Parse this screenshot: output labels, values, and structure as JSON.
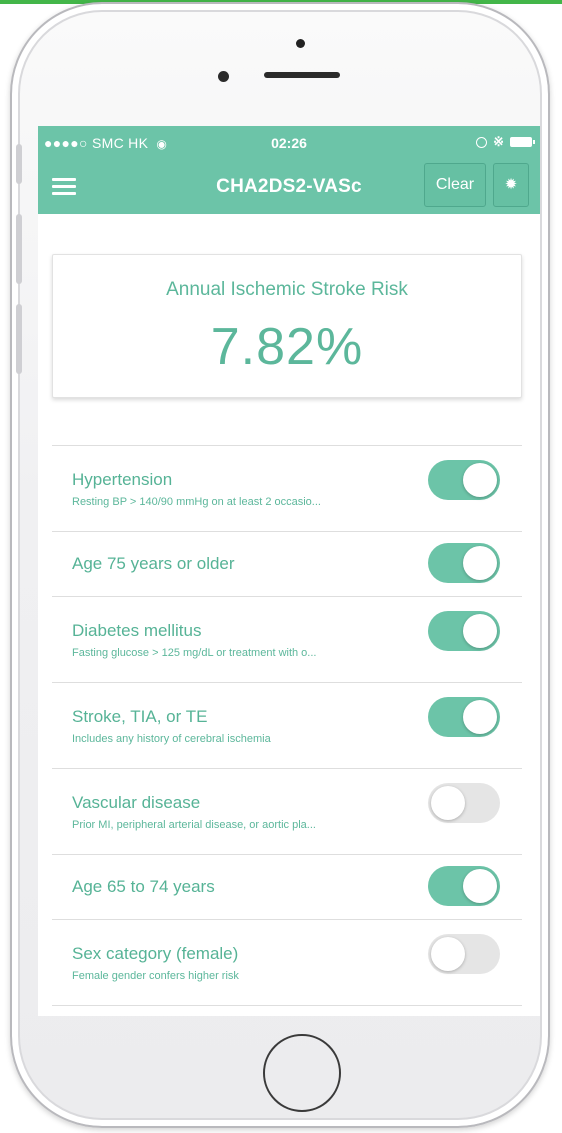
{
  "status_bar": {
    "carrier": "●●●●○ SMC HK",
    "time": "02:26"
  },
  "nav": {
    "title": "CHA2DS2-VASc",
    "clear_label": "Clear"
  },
  "result": {
    "label": "Annual Ischemic Stroke Risk",
    "value": "7.82%"
  },
  "colors": {
    "accent": "#6cc4a8",
    "text_accent": "#5cb79b",
    "toggle_off": "#e5e5e5"
  },
  "items": [
    {
      "title": "Hypertension",
      "subtitle": "Resting BP > 140/90 mmHg on at least 2 occasio...",
      "checked": true
    },
    {
      "title": "Age 75 years or older",
      "subtitle": "",
      "checked": true
    },
    {
      "title": "Diabetes mellitus",
      "subtitle": "Fasting glucose > 125 mg/dL or treatment with o...",
      "checked": true
    },
    {
      "title": "Stroke, TIA, or TE",
      "subtitle": "Includes any history of cerebral ischemia",
      "checked": true
    },
    {
      "title": "Vascular disease",
      "subtitle": "Prior MI, peripheral arterial disease, or aortic pla...",
      "checked": false
    },
    {
      "title": "Age 65 to 74 years",
      "subtitle": "",
      "checked": true
    },
    {
      "title": "Sex category (female)",
      "subtitle": "Female gender confers higher risk",
      "checked": false
    }
  ]
}
